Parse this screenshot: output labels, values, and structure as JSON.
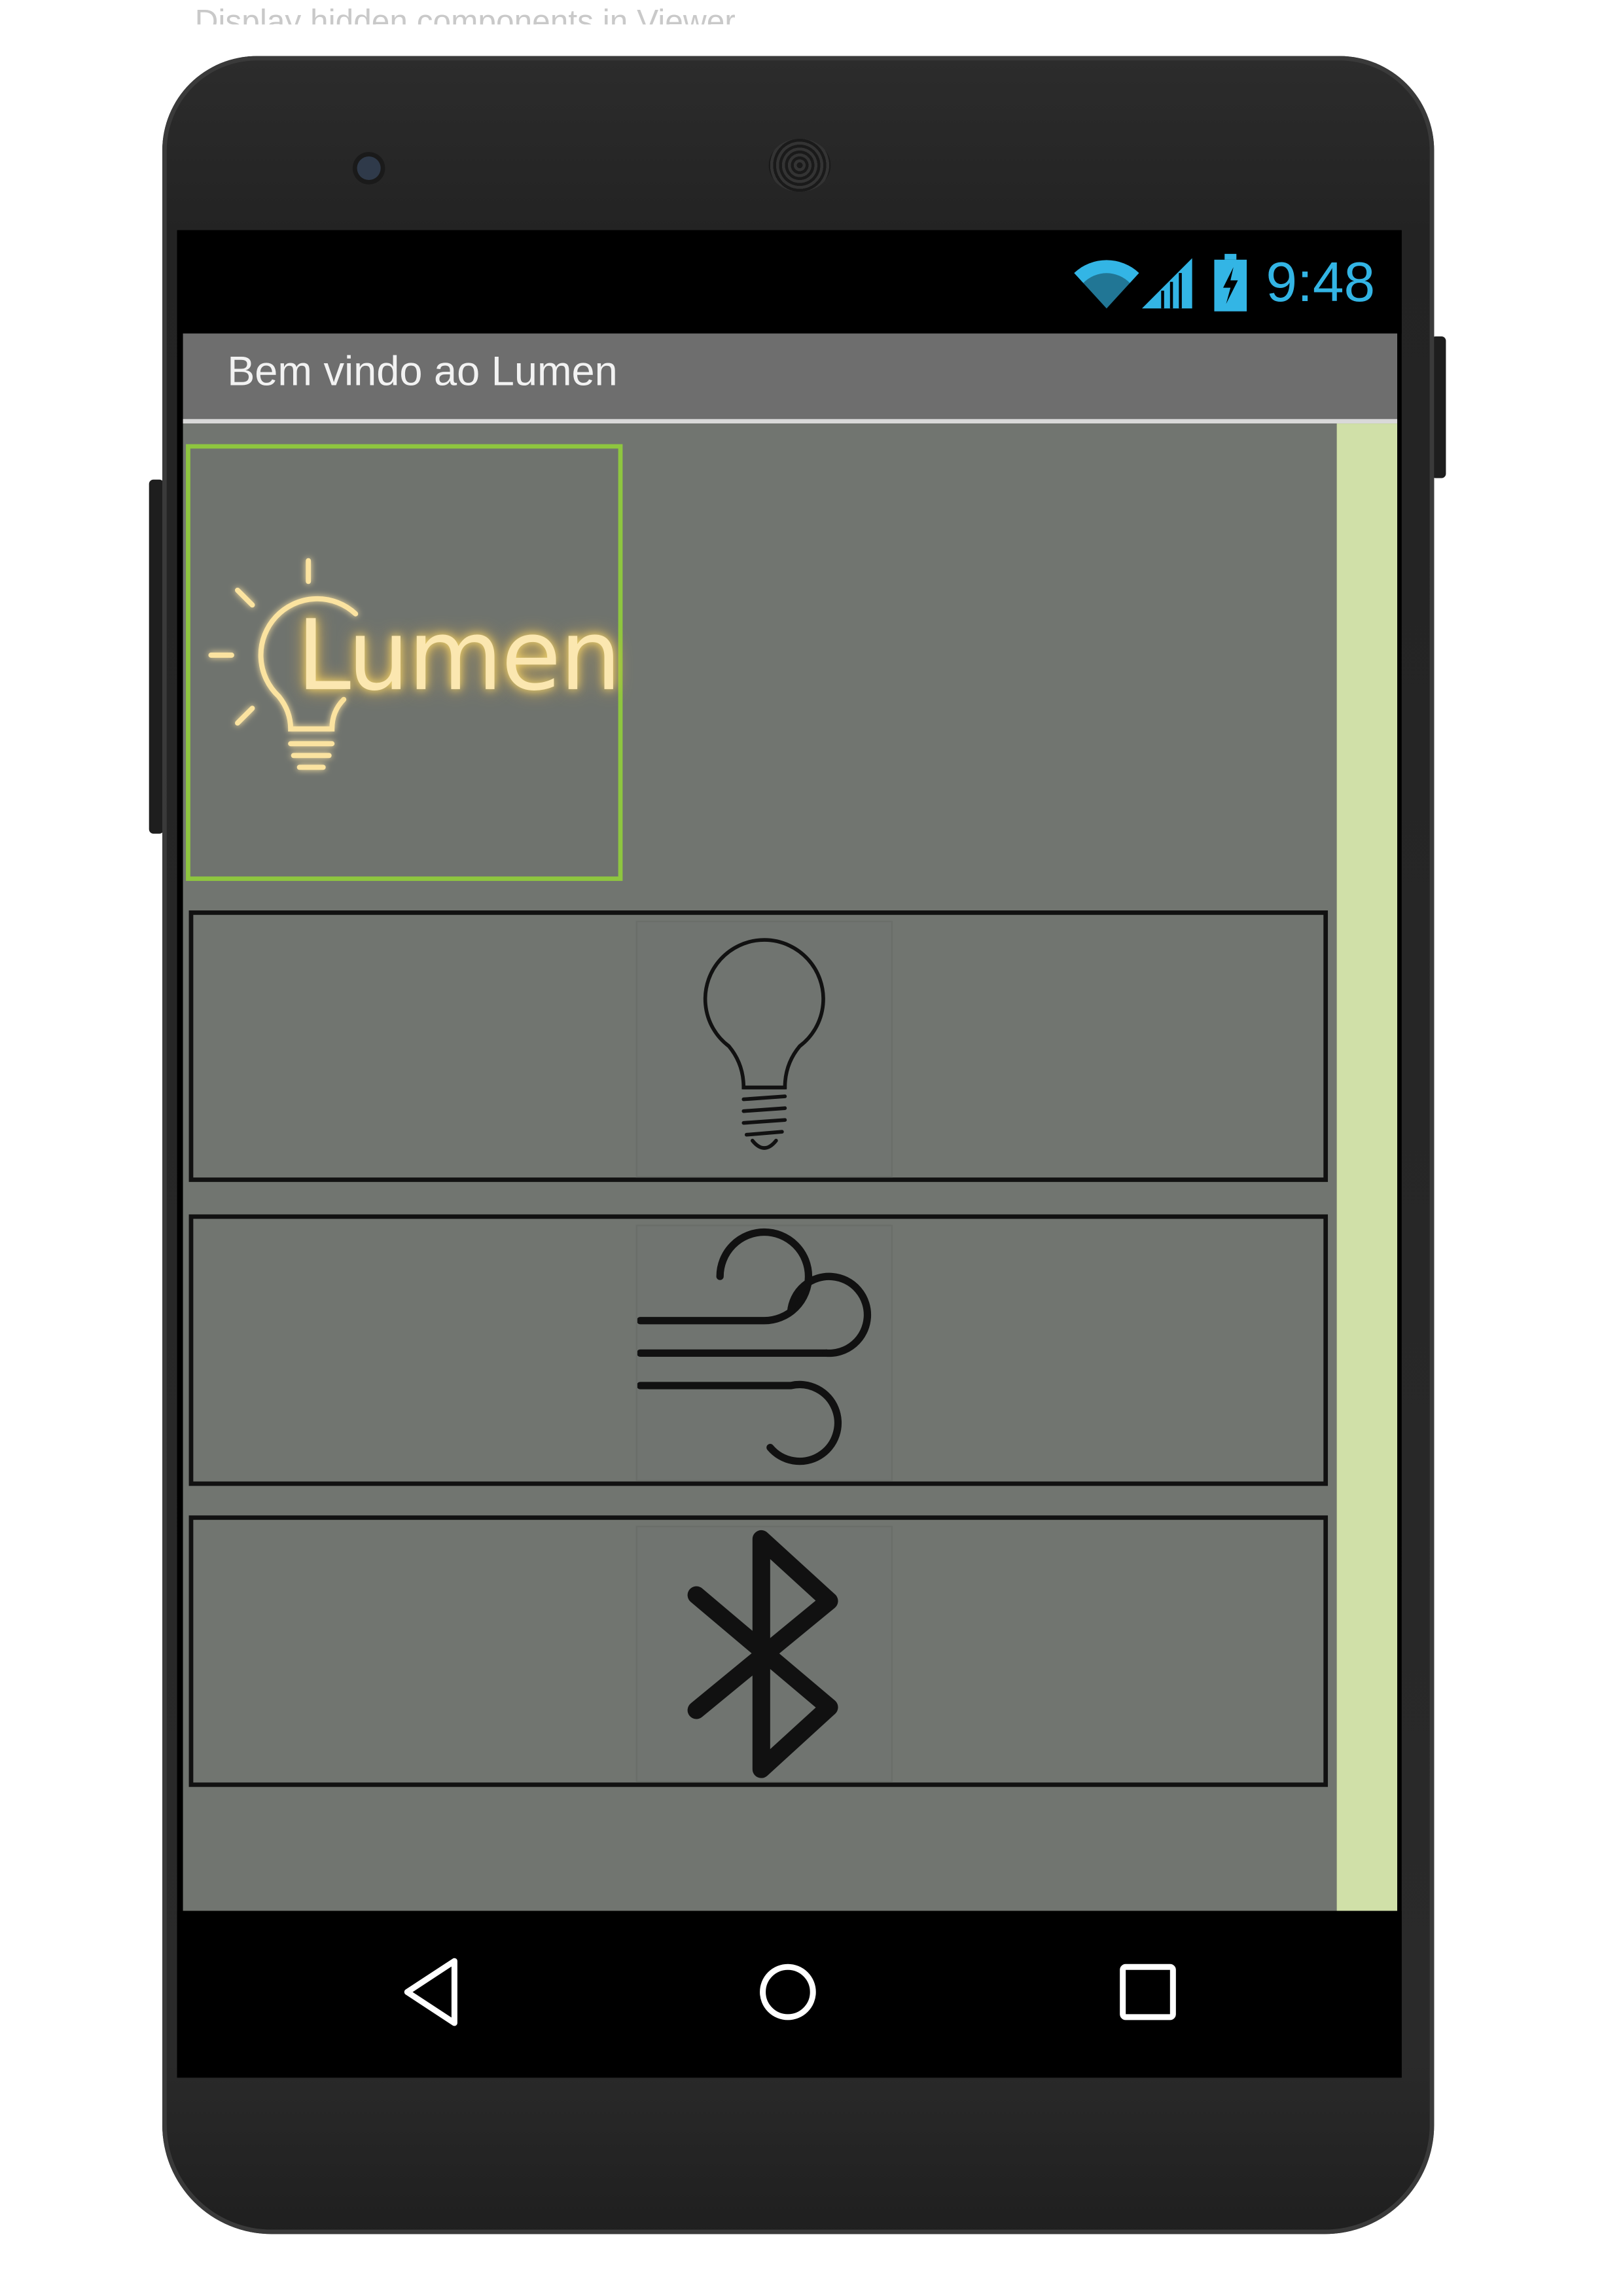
{
  "caption": "Display hidden components in Viewer",
  "statusbar": {
    "time": "9:48",
    "icons": [
      "wifi-icon",
      "signal-icon",
      "battery-charging-icon"
    ],
    "accent_color": "#33b5e5"
  },
  "titlebar": {
    "title": "Bem vindo ao Lumen"
  },
  "logo": {
    "text": "Lumen",
    "icon": "lightbulb-logo-icon",
    "glow_color": "#f5d76e"
  },
  "buttons": [
    {
      "name": "lamp-button",
      "icon": "lightbulb-icon"
    },
    {
      "name": "fan-button",
      "icon": "wind-icon"
    },
    {
      "name": "bluetooth-button",
      "icon": "bluetooth-icon"
    }
  ],
  "navbar": {
    "icons": [
      "back-icon",
      "home-icon",
      "recents-icon"
    ]
  },
  "colors": {
    "content_bg": "#717570",
    "titlebar_bg": "#6e6e6e",
    "scrollbar": "#d0e0a8",
    "logo_border": "#8ec63f"
  }
}
